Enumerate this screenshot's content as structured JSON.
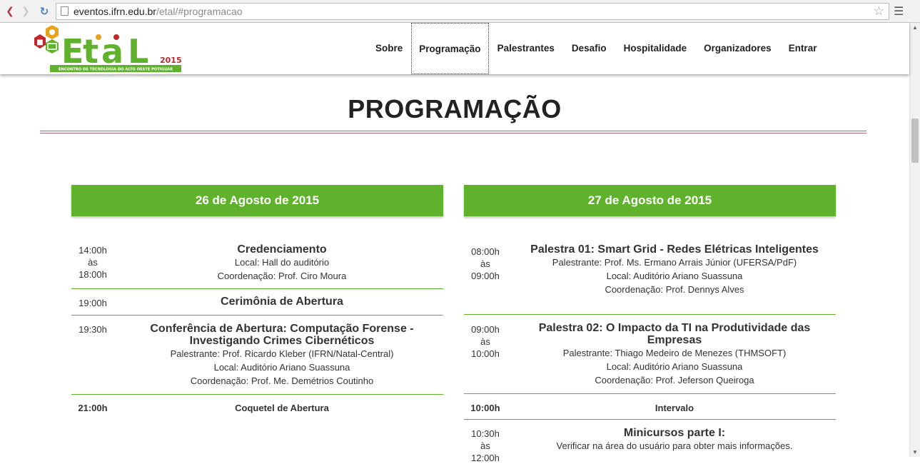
{
  "browser": {
    "url_host": "eventos.ifrn.edu.br",
    "url_path": "/etal/#programacao"
  },
  "site": {
    "logo_year": "2015",
    "logo_tagline": "ENCONTRO DE TECNOLOGIA DO ALTO OESTE POTIGUAR",
    "nav": [
      "Sobre",
      "Programação",
      "Palestrantes",
      "Desafio",
      "Hospitalidade",
      "Organizadores",
      "Entrar"
    ],
    "active_nav": "Programação"
  },
  "page_title": "PROGRAMAÇÃO",
  "days": [
    {
      "title": "26 de Agosto de 2015",
      "items": [
        {
          "time": [
            "14:00h",
            "às",
            "18:00h"
          ],
          "title": "Credenciamento",
          "lines": [
            "Local: Hall do auditório",
            "Coordenação: Prof. Ciro Moura"
          ]
        },
        {
          "time": [
            "19:00h"
          ],
          "title": "Cerimônia de Abertura",
          "lines": []
        },
        {
          "time": [
            "19:30h"
          ],
          "title": "Conferência de Abertura: Computação Forense - Investigando Crimes Cibernéticos",
          "lines": [
            "Palestrante: Prof. Ricardo Kleber (IFRN/Natal-Central)",
            "Local: Auditório Ariano Suassuna",
            "Coordenação: Prof. Me. Demétrios Coutinho"
          ]
        },
        {
          "time": [
            "21:00h"
          ],
          "title": "Coquetel de Abertura",
          "lines": []
        }
      ]
    },
    {
      "title": "27 de Agosto de 2015",
      "items": [
        {
          "time": [
            "08:00h",
            "às",
            "09:00h"
          ],
          "title": "Palestra 01: Smart Grid - Redes Elétricas Inteligentes",
          "lines": [
            "Palestrante: Prof. Ms. Ermano Arrais Júnior (UFERSA/PdF)",
            "Local: Auditório Ariano Suassuna",
            "Coordenação: Prof. Dennys Alves"
          ]
        },
        {
          "time": [
            "09:00h",
            "às",
            "10:00h"
          ],
          "title": "Palestra 02: O Impacto da TI na Produtividade das Empresas",
          "lines": [
            "Palestrante: Thiago Medeiro de Menezes (THMSOFT)",
            "Local: Auditório Ariano Suassuna",
            "Coordenação: Prof. Jeferson Queiroga"
          ]
        },
        {
          "time": [
            "10:00h"
          ],
          "title": "Intervalo",
          "lines": []
        },
        {
          "time": [
            "10:30h",
            "às",
            "12:00h"
          ],
          "title": "Minicursos parte I:",
          "lines": [
            "Verificar na área do usuário para obter mais informações."
          ]
        }
      ]
    }
  ]
}
